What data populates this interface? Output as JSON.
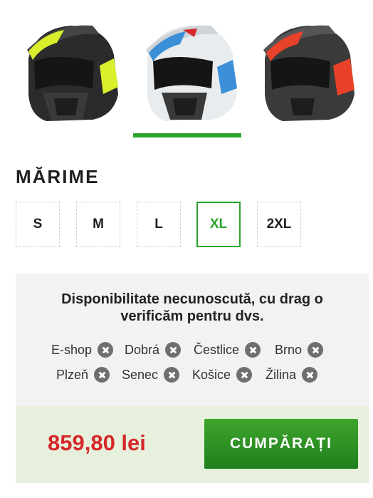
{
  "variants": [
    {
      "name": "helmet-variant-yellow",
      "accent": "#d9ef2b",
      "shell": "#2b2b2b"
    },
    {
      "name": "helmet-variant-blue",
      "accent": "#3a8fd6",
      "shell": "#e9ecef"
    },
    {
      "name": "helmet-variant-red",
      "accent": "#e8432a",
      "shell": "#3a3a3a"
    }
  ],
  "size": {
    "title": "MĂRIME",
    "options": [
      "S",
      "M",
      "L",
      "XL",
      "2XL"
    ],
    "selected": "XL"
  },
  "availability": {
    "message": "Disponibilitate necunoscută, cu drag o verificăm pentru dvs.",
    "stores": [
      "E-shop",
      "Dobrá",
      "Čestlice",
      "Brno",
      "Plzeň",
      "Senec",
      "Košice",
      "Žilina"
    ]
  },
  "purchase": {
    "price": "859,80 lei",
    "button_label": "CUMPĂRAȚI"
  },
  "colors": {
    "brand_green": "#2aa52a",
    "price_red": "#d5282b"
  }
}
